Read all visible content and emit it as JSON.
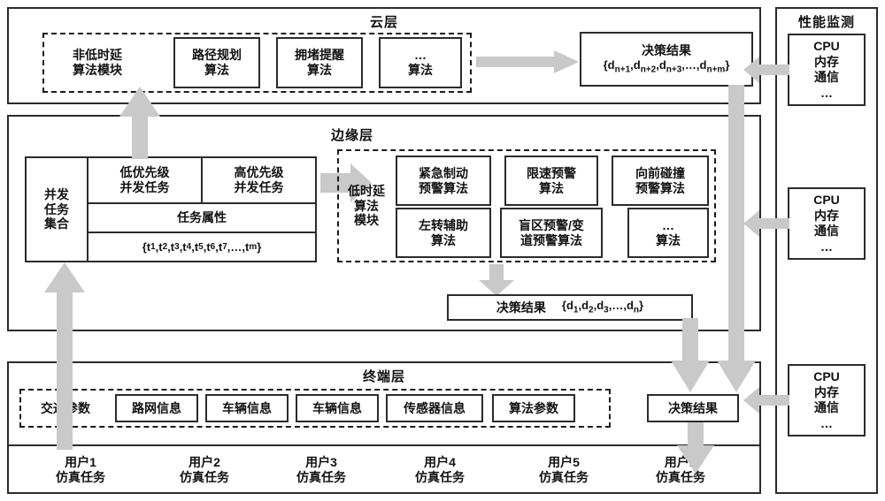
{
  "colors": {
    "arrow": "#c9c9c9",
    "stroke": "#2b2b2b",
    "background": "#ffffff"
  },
  "cloud_layer": {
    "title": "云层",
    "module_label": "非低时延\n算法模块",
    "algorithms": [
      "路径规划\n算法",
      "拥堵提醒\n算法",
      "…\n算法"
    ],
    "decision": {
      "title": "决策结果",
      "set": "{d",
      "set_full": "{dn+1,dn+2,dn+3,…,dn+m}"
    }
  },
  "edge_layer": {
    "title": "边缘层",
    "task_set_label": "并发\n任务\n集合",
    "low_priority_label": "低优先级\n并发任务",
    "high_priority_label": "高优先级\n并发任务",
    "task_attribute_label": "任务属性",
    "task_set_items": "{t1,t2,t3,t4,t5,t6,t7,…,tm}",
    "module_label": "低时延\n算法\n模块",
    "algorithms": [
      "紧急制动\n预警算法",
      "限速预警\n算法",
      "向前碰撞\n预警算法",
      "左转辅助\n算法",
      "盲区预警/变\n道预警算法",
      "…\n算法"
    ],
    "decision": {
      "title": "决策结果",
      "set_full": "{d1,d2,d3,…,dn}"
    }
  },
  "terminal_layer": {
    "title": "终端层",
    "params": [
      "交通参数",
      "路网信息",
      "车辆信息",
      "车辆信息",
      "传感器信息",
      "算法参数"
    ],
    "decision_label": "决策结果",
    "users": [
      "用户1\n仿真任务",
      "用户2\n仿真任务",
      "用户3\n仿真任务",
      "用户4\n仿真任务",
      "用户5\n仿真任务",
      "用户n\n仿真任务"
    ]
  },
  "monitor_panel": {
    "title": "性能监测",
    "cards": [
      "CPU\n内存\n通信\n…",
      "CPU\n内存\n通信\n…",
      "CPU\n内存\n通信\n…"
    ]
  }
}
